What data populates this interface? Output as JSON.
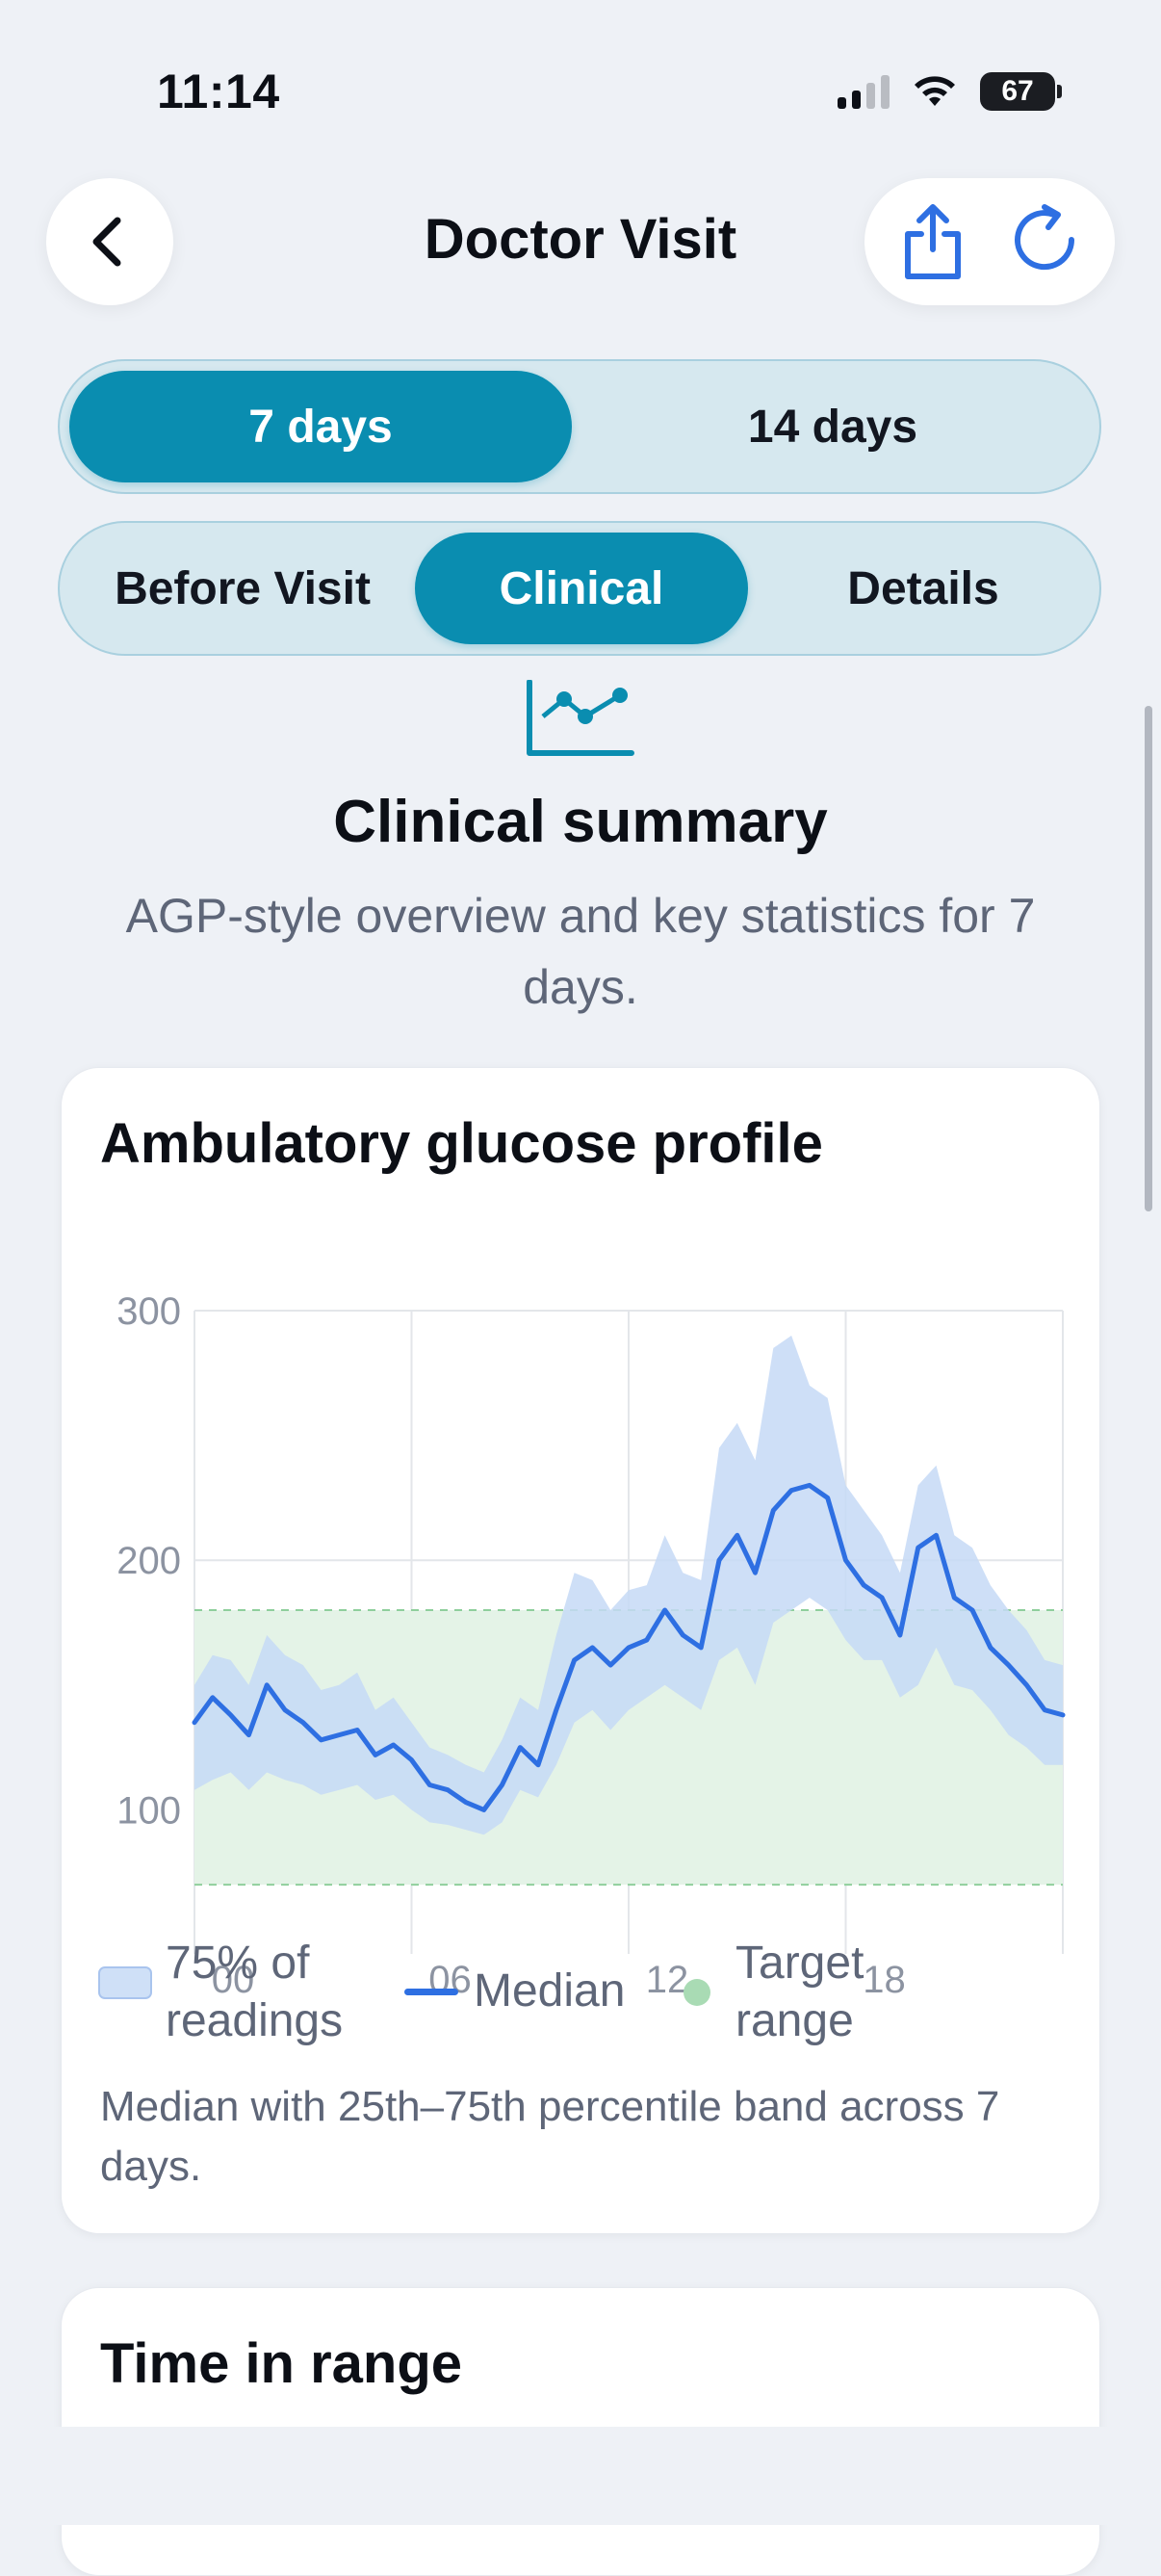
{
  "status": {
    "time": "11:14",
    "battery": "67"
  },
  "nav": {
    "title": "Doctor Visit"
  },
  "range_toggle": {
    "options": [
      "7 days",
      "14 days"
    ],
    "selected": 0
  },
  "tabs": {
    "items": [
      "Before Visit",
      "Clinical",
      "Details"
    ],
    "selected": 1
  },
  "hero": {
    "title": "Clinical summary",
    "subtitle": "AGP-style overview and key statistics for 7 days.",
    "icon": "chart-line-icon"
  },
  "agp_card": {
    "title": "Ambulatory glucose profile",
    "legend": {
      "band": "75% of readings",
      "median": "Median",
      "target": "Target range"
    },
    "note": "Median with 25th–75th percentile band across 7 days."
  },
  "tir_card": {
    "title": "Time in range"
  },
  "colors": {
    "accent": "#0a8db0",
    "median": "#2e6fe2",
    "band": "#cfe0f7",
    "target": "#a9dbb4"
  },
  "chart_data": {
    "type": "area",
    "title": "Ambulatory glucose profile",
    "x_tick_labels": [
      "00",
      "06",
      "12",
      "18"
    ],
    "y_tick_labels": [
      "300",
      "200",
      "100"
    ],
    "xlim": [
      0,
      24
    ],
    "ylim": [
      50,
      300
    ],
    "grid": true,
    "target_range": [
      70,
      180
    ],
    "x": [
      0,
      0.5,
      1,
      1.5,
      2,
      2.5,
      3,
      3.5,
      4,
      4.5,
      5,
      5.5,
      6,
      6.5,
      7,
      7.5,
      8,
      8.5,
      9,
      9.5,
      10,
      10.5,
      11,
      11.5,
      12,
      12.5,
      13,
      13.5,
      14,
      14.5,
      15,
      15.5,
      16,
      16.5,
      17,
      17.5,
      18,
      18.5,
      19,
      19.5,
      20,
      20.5,
      21,
      21.5,
      22,
      22.5,
      23,
      23.5,
      24
    ],
    "series": [
      {
        "name": "Median",
        "values": [
          135,
          145,
          138,
          130,
          150,
          140,
          135,
          128,
          130,
          132,
          122,
          126,
          120,
          110,
          108,
          103,
          100,
          110,
          125,
          118,
          140,
          160,
          165,
          158,
          165,
          168,
          180,
          170,
          165,
          200,
          210,
          195,
          220,
          228,
          230,
          225,
          200,
          190,
          185,
          170,
          205,
          210,
          185,
          180,
          165,
          158,
          150,
          140,
          138
        ]
      },
      {
        "name": "75% of readings",
        "values_low": [
          108,
          112,
          115,
          108,
          115,
          112,
          110,
          106,
          108,
          110,
          104,
          106,
          100,
          95,
          94,
          92,
          90,
          95,
          108,
          105,
          118,
          135,
          140,
          132,
          140,
          145,
          150,
          145,
          140,
          160,
          165,
          150,
          175,
          180,
          185,
          180,
          168,
          160,
          160,
          145,
          150,
          165,
          150,
          148,
          140,
          130,
          125,
          118,
          118
        ],
        "values_high": [
          150,
          162,
          160,
          150,
          170,
          162,
          158,
          148,
          150,
          155,
          140,
          145,
          135,
          125,
          122,
          118,
          115,
          128,
          145,
          140,
          170,
          195,
          192,
          180,
          188,
          190,
          210,
          195,
          192,
          245,
          255,
          240,
          285,
          290,
          270,
          265,
          230,
          220,
          210,
          195,
          230,
          238,
          210,
          205,
          190,
          180,
          172,
          160,
          158
        ]
      }
    ]
  }
}
